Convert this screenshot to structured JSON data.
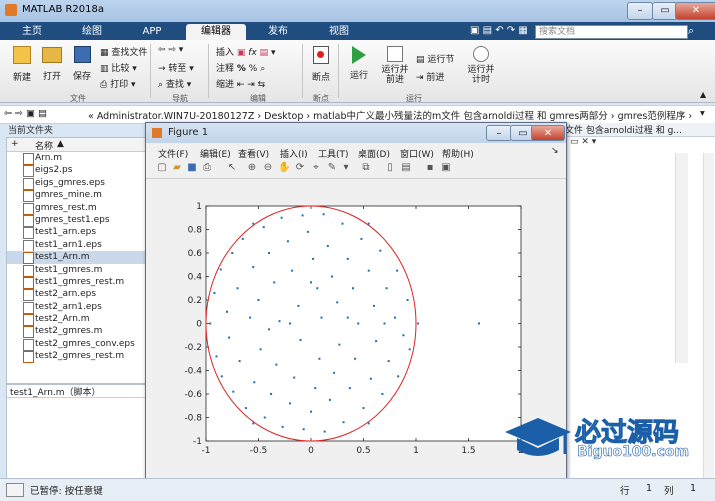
{
  "app": {
    "title": "MATLAB R2018a"
  },
  "tabs": [
    {
      "label": "主页"
    },
    {
      "label": "绘图"
    },
    {
      "label": "APP"
    },
    {
      "label": "编辑器"
    },
    {
      "label": "发布"
    },
    {
      "label": "视图"
    }
  ],
  "search": {
    "placeholder": "搜索文档"
  },
  "ribbon": {
    "new": "新建",
    "open": "打开",
    "save": "保存",
    "find_file": "查找文件",
    "compare": "比较",
    "print": "打印",
    "goto": "转至",
    "find": "查找",
    "insert": "插入",
    "comment": "注释",
    "indent": "缩进",
    "breakpoint": "断点",
    "run": "运行",
    "run_advance": "运行并\n前进",
    "run_section": "运行节",
    "advance": "前进",
    "run_time": "运行并\n计时",
    "groups": {
      "file": "文件",
      "nav": "导航",
      "edit": "编辑",
      "breakpoint": "断点",
      "run": "运行"
    }
  },
  "address": {
    "path": "« Administrator.WIN7U-20180127Z  ›  Desktop  ›  matlab中广义最小残量法的m文件 包含arnoldi过程 和 gmres两部分  ›  gmres范例程序  ›"
  },
  "left": {
    "current_folder": "当前文件夹",
    "name_header": "名称",
    "files": [
      {
        "name": "Arn.m",
        "type": "m"
      },
      {
        "name": "eigs2.ps",
        "type": "ps"
      },
      {
        "name": "eigs_gmres.eps",
        "type": "eps"
      },
      {
        "name": "gmres_mine.m",
        "type": "m"
      },
      {
        "name": "gmres_rest.m",
        "type": "m"
      },
      {
        "name": "gmres_test1.eps",
        "type": "eps"
      },
      {
        "name": "test1_arn.eps",
        "type": "eps"
      },
      {
        "name": "test1_arn1.eps",
        "type": "eps"
      },
      {
        "name": "test1_Arn.m",
        "type": "m",
        "selected": true
      },
      {
        "name": "test1_gmres.m",
        "type": "m"
      },
      {
        "name": "test1_gmres_rest.m",
        "type": "m"
      },
      {
        "name": "test2_arn.eps",
        "type": "eps"
      },
      {
        "name": "test2_arn1.eps",
        "type": "eps"
      },
      {
        "name": "test2_Arn.m",
        "type": "m"
      },
      {
        "name": "test2_gmres.m",
        "type": "m"
      },
      {
        "name": "test2_gmres_conv.eps",
        "type": "eps"
      },
      {
        "name": "test2_gmres_rest.m",
        "type": "m"
      }
    ],
    "details": "test1_Arn.m（脚本）"
  },
  "figure": {
    "title": "Figure 1",
    "menu": [
      "文件(F)",
      "编辑(E)",
      "查看(V)",
      "插入(I)",
      "工具(T)",
      "桌面(D)",
      "窗口(W)",
      "帮助(H)"
    ]
  },
  "right": {
    "header": "文件 包含arnoldi过程 和 g..."
  },
  "status": {
    "text": "已暂停: 按任意键",
    "row_label": "行",
    "row": "1",
    "col_label": "列",
    "col": "1"
  },
  "logo": {
    "cn": "必过源码",
    "en": "Biguo100.com"
  },
  "colors": {
    "accent": "#1f4d80",
    "plot_point": "#1f6fb5",
    "circle": "#e02020"
  },
  "chart_data": {
    "type": "scatter",
    "xlim": [
      -1,
      2
    ],
    "ylim": [
      -1,
      1
    ],
    "xticks": [
      -1,
      -0.5,
      0,
      0.5,
      1,
      1.5,
      2
    ],
    "yticks": [
      -1,
      -0.8,
      -0.6,
      -0.4,
      -0.2,
      0,
      0.2,
      0.4,
      0.6,
      0.8,
      1
    ],
    "circle": {
      "cx": 0,
      "cy": 0,
      "r": 1
    },
    "points": [
      [
        -0.96,
        0
      ],
      [
        -0.92,
        0.26
      ],
      [
        -0.9,
        -0.28
      ],
      [
        -0.86,
        0.46
      ],
      [
        -0.85,
        -0.45
      ],
      [
        -0.8,
        0.1
      ],
      [
        -0.78,
        -0.12
      ],
      [
        -0.75,
        0.6
      ],
      [
        -0.74,
        -0.58
      ],
      [
        -0.7,
        0.3
      ],
      [
        -0.68,
        -0.32
      ],
      [
        -0.65,
        0.72
      ],
      [
        -0.62,
        -0.72
      ],
      [
        -0.58,
        0.05
      ],
      [
        -0.55,
        0.48
      ],
      [
        -0.54,
        -0.5
      ],
      [
        -0.5,
        0.2
      ],
      [
        -0.48,
        -0.22
      ],
      [
        -0.45,
        0.82
      ],
      [
        -0.44,
        -0.8
      ],
      [
        -0.4,
        0.6
      ],
      [
        -0.38,
        -0.6
      ],
      [
        -0.35,
        0.35
      ],
      [
        -0.33,
        -0.35
      ],
      [
        -0.3,
        0.02
      ],
      [
        -0.28,
        0.9
      ],
      [
        -0.27,
        -0.88
      ],
      [
        -0.22,
        0.7
      ],
      [
        -0.2,
        -0.68
      ],
      [
        -0.18,
        0.45
      ],
      [
        -0.16,
        -0.46
      ],
      [
        -0.12,
        0.15
      ],
      [
        -0.1,
        -0.14
      ],
      [
        -0.08,
        0.92
      ],
      [
        -0.07,
        -0.9
      ],
      [
        -0.03,
        0.78
      ],
      [
        0,
        -0.75
      ],
      [
        0.02,
        0.55
      ],
      [
        0.04,
        -0.55
      ],
      [
        0.06,
        0.3
      ],
      [
        0.08,
        -0.3
      ],
      [
        0.1,
        0.05
      ],
      [
        0.12,
        0.93
      ],
      [
        0.13,
        -0.92
      ],
      [
        0.16,
        0.66
      ],
      [
        0.18,
        -0.65
      ],
      [
        0.2,
        0.4
      ],
      [
        0.22,
        -0.42
      ],
      [
        0.25,
        0.18
      ],
      [
        0.27,
        -0.18
      ],
      [
        0.3,
        0.85
      ],
      [
        0.31,
        -0.84
      ],
      [
        0.35,
        0.55
      ],
      [
        0.37,
        -0.55
      ],
      [
        0.4,
        0.3
      ],
      [
        0.42,
        -0.3
      ],
      [
        0.45,
        0.0
      ],
      [
        0.48,
        0.72
      ],
      [
        0.5,
        -0.72
      ],
      [
        0.55,
        0.45
      ],
      [
        0.57,
        -0.47
      ],
      [
        0.6,
        0.15
      ],
      [
        0.62,
        -0.15
      ],
      [
        0.66,
        0.62
      ],
      [
        0.68,
        -0.6
      ],
      [
        0.72,
        0.3
      ],
      [
        0.74,
        -0.32
      ],
      [
        0.8,
        0.05
      ],
      [
        0.82,
        0.45
      ],
      [
        0.83,
        -0.45
      ],
      [
        0.88,
        -0.1
      ],
      [
        0.92,
        0.2
      ],
      [
        0.94,
        -0.22
      ],
      [
        1.02,
        0.0
      ],
      [
        1.6,
        0.0
      ],
      [
        -0.55,
        0.85
      ],
      [
        0.55,
        0.85
      ],
      [
        -0.55,
        -0.85
      ],
      [
        0.55,
        -0.85
      ],
      [
        0.0,
        0.35
      ],
      [
        -0.2,
        0.0
      ],
      [
        0.35,
        0.05
      ],
      [
        -0.4,
        -0.05
      ],
      [
        0.7,
        0.0
      ]
    ]
  }
}
